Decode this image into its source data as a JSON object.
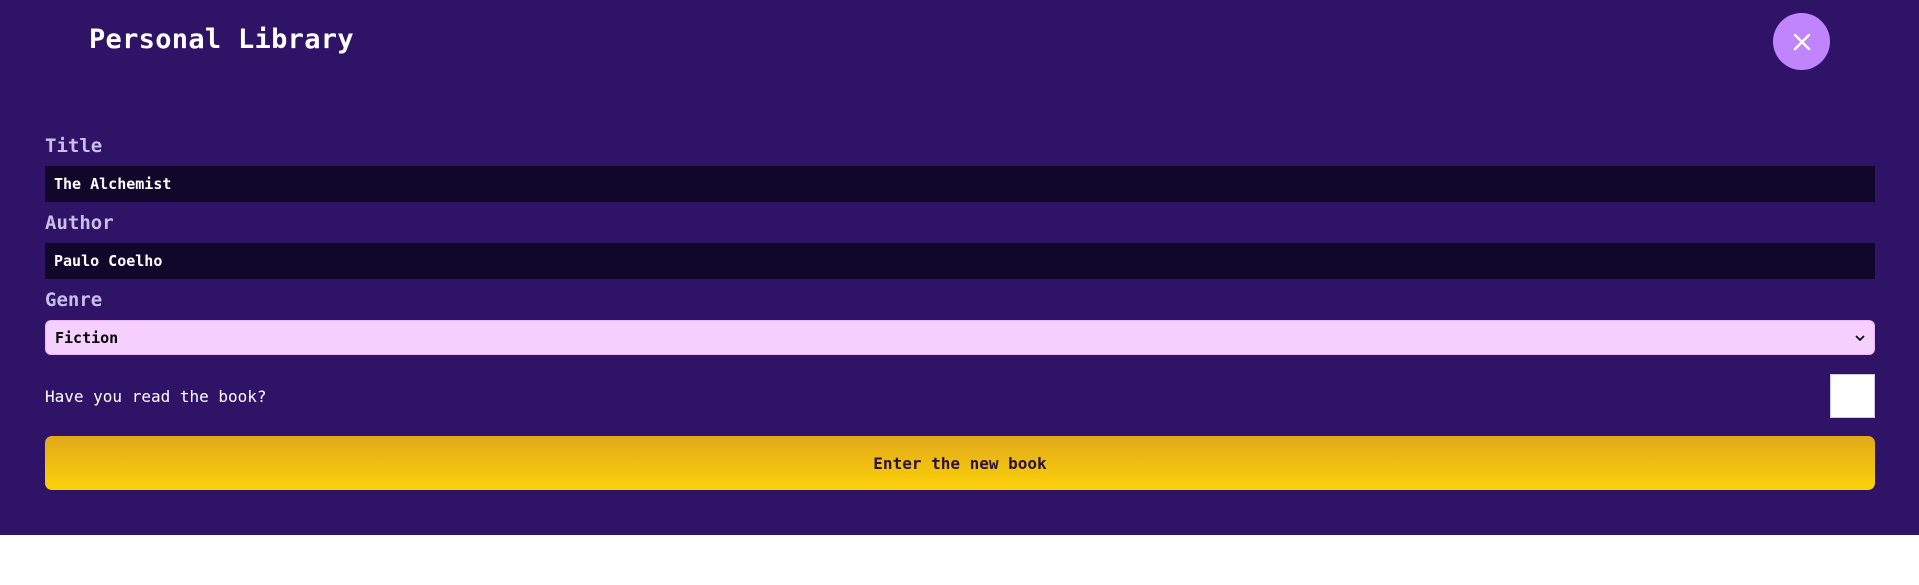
{
  "header": {
    "title": "Personal Library",
    "close_icon": "close-icon"
  },
  "form": {
    "title_label": "Title",
    "title_value": "The Alchemist",
    "author_label": "Author",
    "author_value": "Paulo Coelho",
    "genre_label": "Genre",
    "genre_selected": "Fiction",
    "read_label": "Have you read the book?",
    "read_checked": false,
    "submit_label": "Enter the new book"
  },
  "colors": {
    "panel_bg": "#2e1367",
    "close_button": "#c084fc",
    "input_bg": "#11072b",
    "select_bg": "#f5d0fe",
    "submit_gradient_top": "#e0a81a",
    "submit_gradient_bottom": "#fcd209"
  }
}
